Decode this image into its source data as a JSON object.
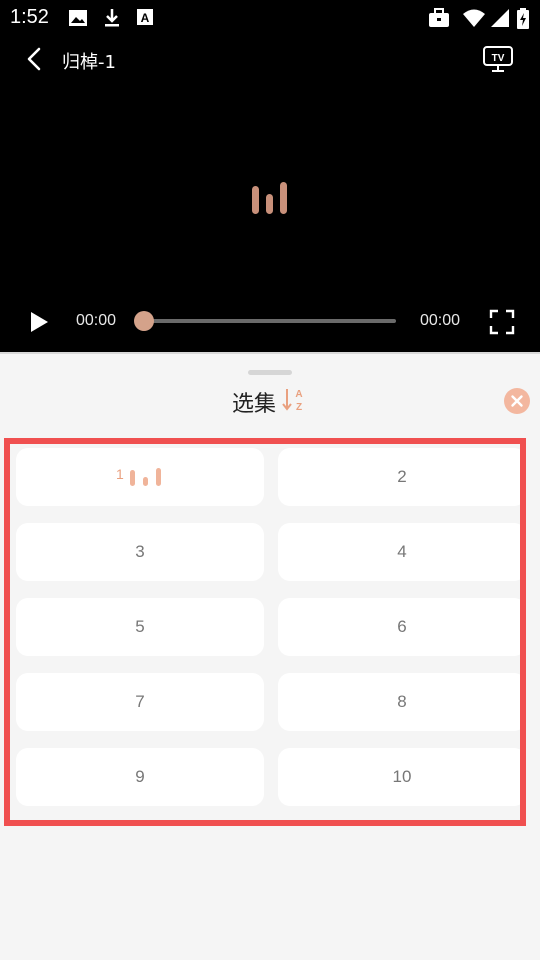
{
  "status_bar": {
    "time": "1:52",
    "icons": [
      "image-icon",
      "download-icon",
      "a-icon",
      "briefcase-icon",
      "wifi-icon",
      "signal-icon",
      "battery-icon"
    ]
  },
  "player": {
    "title": "归棹-1",
    "current_time": "00:00",
    "total_time": "00:00",
    "progress": 0,
    "accent_color": "#d4a28a"
  },
  "panel": {
    "title": "选集",
    "sort_icon": "sort-az-icon",
    "close_icon": "close-icon",
    "episodes": [
      "1",
      "2",
      "3",
      "4",
      "5",
      "6",
      "7",
      "8",
      "9",
      "10"
    ],
    "active_episode": "1"
  }
}
